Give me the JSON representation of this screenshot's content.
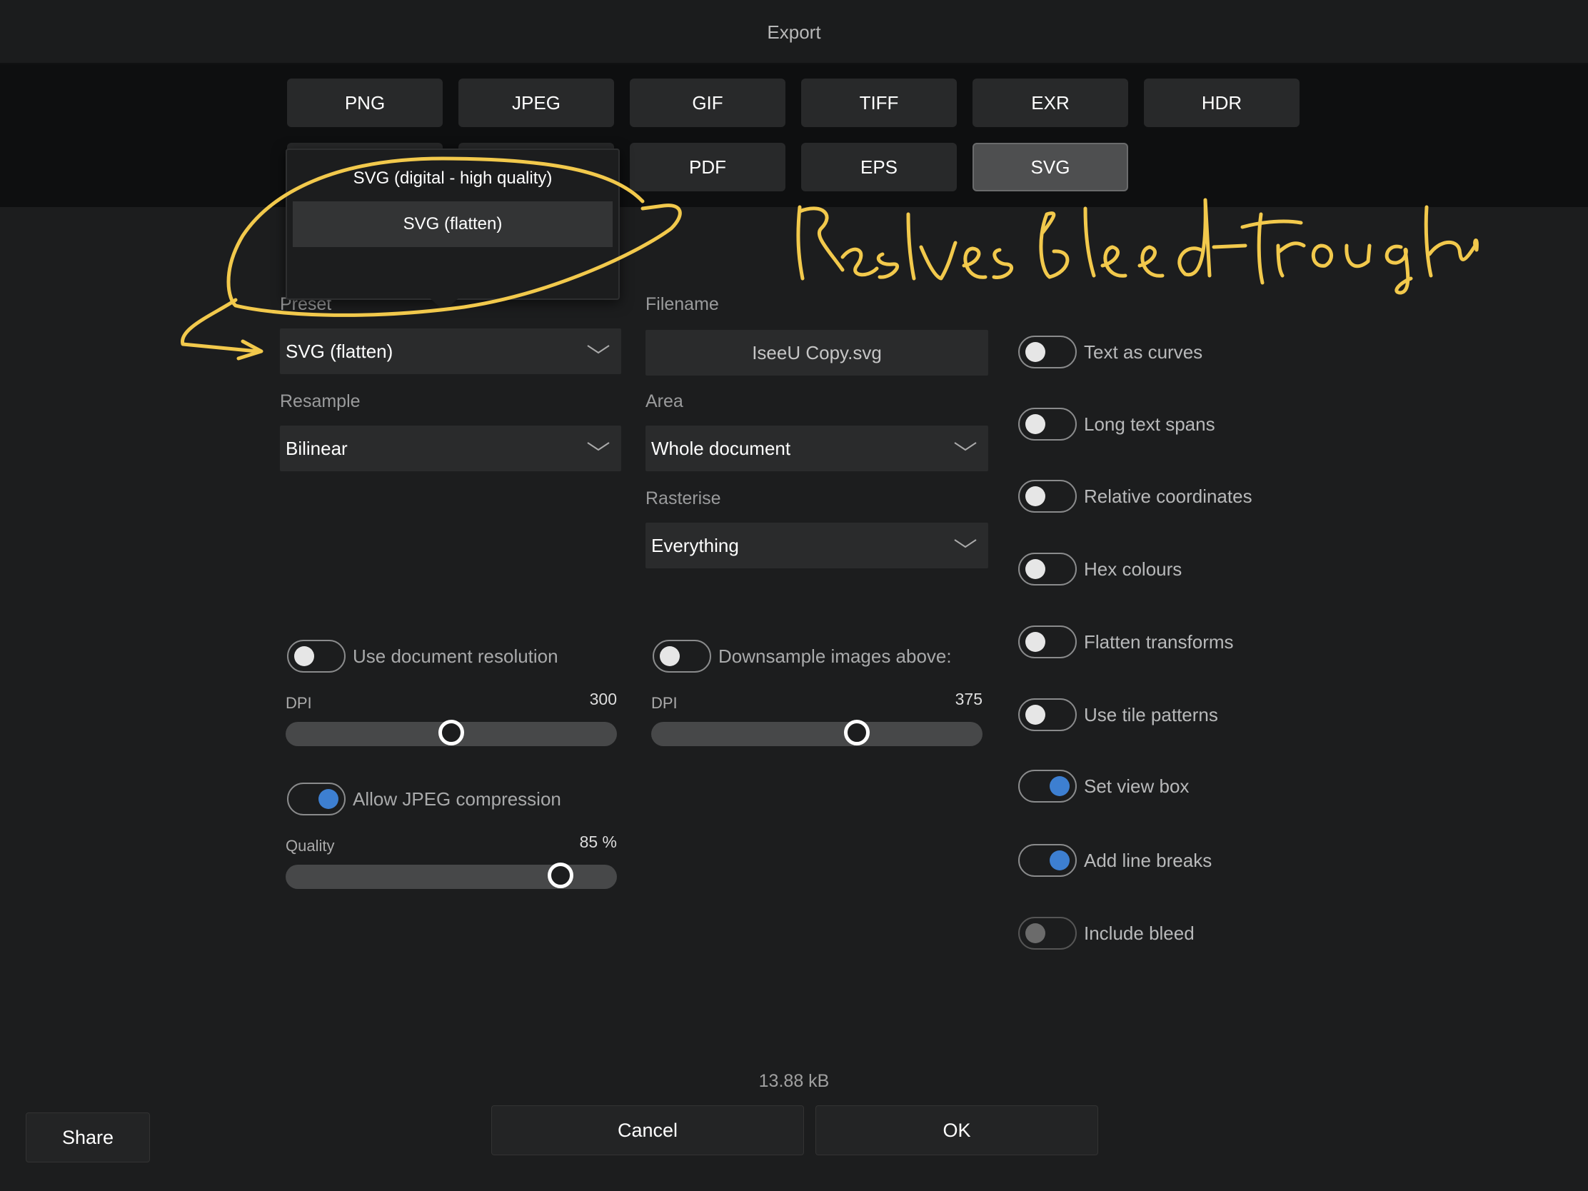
{
  "window": {
    "title": "Export"
  },
  "formats": {
    "row1": [
      "PNG",
      "JPEG",
      "GIF",
      "TIFF",
      "EXR",
      "HDR"
    ],
    "row2": [
      "PDF",
      "EPS",
      "SVG"
    ],
    "selected": "SVG"
  },
  "preset_popover": {
    "items": [
      "SVG (digital - high quality)",
      "SVG (flatten)"
    ],
    "selected": "SVG (flatten)"
  },
  "left_col": {
    "preset_label": "Preset",
    "preset_value": "SVG (flatten)",
    "resample_label": "Resample",
    "resample_value": "Bilinear",
    "use_doc_res_label": "Use document resolution",
    "dpi_label": "DPI",
    "dpi_value": "300",
    "dpi_fraction": 0.5,
    "jpeg_label": "Allow JPEG compression",
    "quality_label": "Quality",
    "quality_value": "85 %",
    "quality_fraction": 0.83
  },
  "mid_col": {
    "filename_label": "Filename",
    "filename_value": "IseeU Copy.svg",
    "area_label": "Area",
    "area_value": "Whole document",
    "rasterise_label": "Rasterise",
    "rasterise_value": "Everything",
    "downsample_label": "Downsample images above:",
    "dpi_label": "DPI",
    "dpi_value": "375",
    "dpi_fraction": 0.62
  },
  "right_col": {
    "toggles": [
      {
        "label": "Text as curves",
        "state": "off"
      },
      {
        "label": "Long text spans",
        "state": "off"
      },
      {
        "label": "Relative coordinates",
        "state": "off"
      },
      {
        "label": "Hex colours",
        "state": "off"
      },
      {
        "label": "Flatten transforms",
        "state": "off"
      },
      {
        "label": "Use tile patterns",
        "state": "off"
      },
      {
        "label": "Set view box",
        "state": "on"
      },
      {
        "label": "Add line breaks",
        "state": "on"
      },
      {
        "label": "Include bleed",
        "state": "disabled"
      }
    ]
  },
  "toggles_left": {
    "use_doc_res": "off",
    "jpeg": "on",
    "downsample": "off"
  },
  "footer": {
    "file_size": "13.88 kB",
    "cancel": "Cancel",
    "ok": "OK",
    "share": "Share"
  },
  "annotation": {
    "handwritten_text": "Resolves bleed-through",
    "color": "#f2c94c"
  }
}
